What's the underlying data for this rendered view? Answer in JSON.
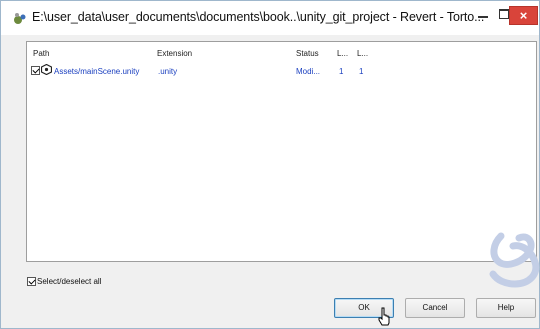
{
  "window": {
    "title": "E:\\user_data\\user_documents\\documents\\book..\\unity_git_project - Revert - Torto...",
    "close_glyph": "×"
  },
  "list": {
    "columns": [
      "Path",
      "Extension",
      "Status",
      "L...",
      "L..."
    ],
    "rows": [
      {
        "checked": true,
        "icon": "unity-icon",
        "path": "Assets/mainScene.unity",
        "extension": ".unity",
        "status": "Modi...",
        "l1": "1",
        "l2": "1"
      }
    ]
  },
  "select_all": {
    "label": "Select/deselect all",
    "checked": true
  },
  "buttons": {
    "ok": "OK",
    "cancel": "Cancel",
    "help": "Help"
  },
  "colors": {
    "link_blue": "#1a3fbf",
    "close_red": "#d9443a",
    "watermark": "#c3cee6"
  }
}
